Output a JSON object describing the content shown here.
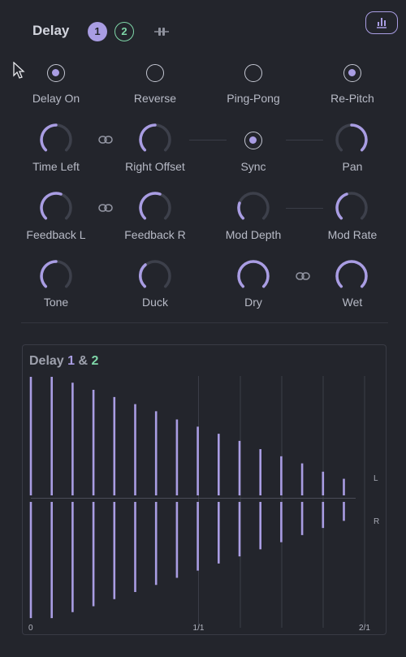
{
  "header": {
    "title": "Delay",
    "tab1": "1",
    "tab2": "2"
  },
  "toggles": [
    {
      "label": "Delay On",
      "checked": true
    },
    {
      "label": "Reverse",
      "checked": false
    },
    {
      "label": "Ping-Pong",
      "checked": false
    },
    {
      "label": "Re-Pitch",
      "checked": true
    }
  ],
  "knobs": {
    "time_left": "Time Left",
    "right_offset": "Right Offset",
    "sync": "Sync",
    "pan": "Pan",
    "feedback_l": "Feedback L",
    "feedback_r": "Feedback R",
    "mod_depth": "Mod Depth",
    "mod_rate": "Mod Rate",
    "tone": "Tone",
    "duck": "Duck",
    "dry": "Dry",
    "wet": "Wet"
  },
  "graph": {
    "title_prefix": "Delay",
    "title_a": "1",
    "amp": "&",
    "title_b": "2",
    "channel_l": "L",
    "channel_r": "R",
    "axis": [
      "0",
      "1/1",
      "2/1"
    ]
  },
  "chart_data": {
    "type": "bar",
    "title": "Delay 1 & 2",
    "x_ticks": [
      "0",
      "1/1",
      "2/1"
    ],
    "series": [
      {
        "name": "L",
        "values": [
          1.0,
          1.0,
          0.95,
          0.89,
          0.83,
          0.77,
          0.71,
          0.64,
          0.58,
          0.52,
          0.46,
          0.39,
          0.33,
          0.27,
          0.2,
          0.14
        ]
      },
      {
        "name": "R",
        "values": [
          0.98,
          0.98,
          0.93,
          0.88,
          0.82,
          0.76,
          0.7,
          0.64,
          0.58,
          0.52,
          0.46,
          0.4,
          0.34,
          0.28,
          0.22,
          0.16
        ]
      }
    ],
    "accent": "#a99de3",
    "accent2": "#7fd6a8"
  }
}
